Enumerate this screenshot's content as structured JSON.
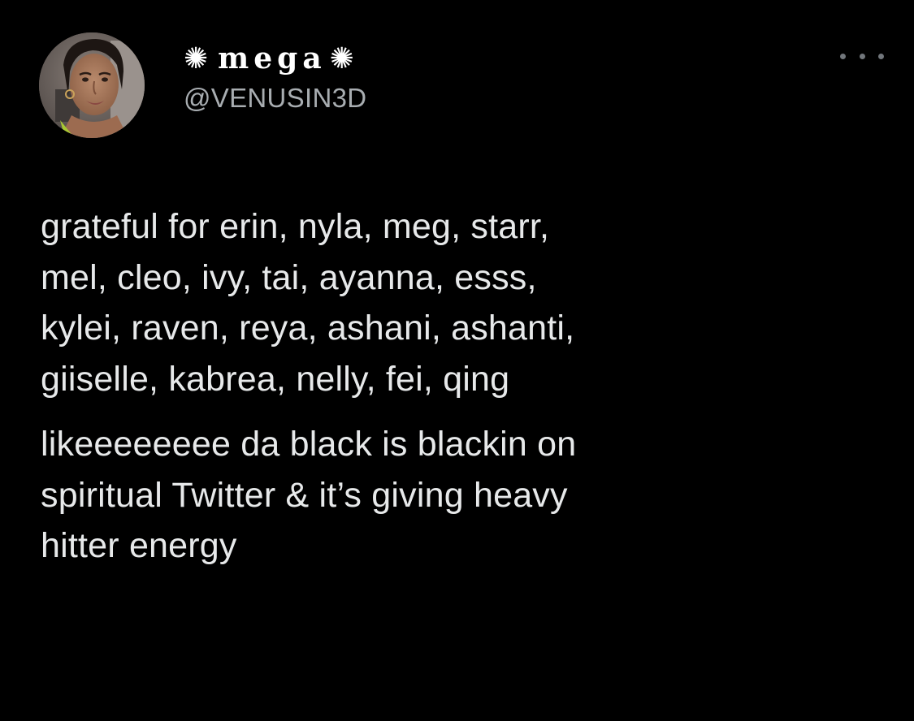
{
  "tweet": {
    "author": {
      "display_name": "mega",
      "decoration_glyph": "✺",
      "handle": "@VENUSIN3D",
      "avatar_icon": "profile-photo"
    },
    "more_icon": "more-options-icon",
    "paragraphs": [
      {
        "lines": [
          "grateful for erin, nyla, meg, starr,",
          "mel, cleo, ivy, tai, ayanna, esss,",
          "kylei, raven, reya, ashani, ashanti,",
          "giiselle, kabrea, nelly, fei, qing"
        ]
      },
      {
        "lines": [
          "likeeeeeeee da black is blackin on",
          "spiritual Twitter & it’s giving heavy",
          "hitter energy"
        ]
      }
    ],
    "colors": {
      "background": "#000000",
      "text": "#e7e9ea",
      "secondary_text": "#a8adb1"
    }
  }
}
